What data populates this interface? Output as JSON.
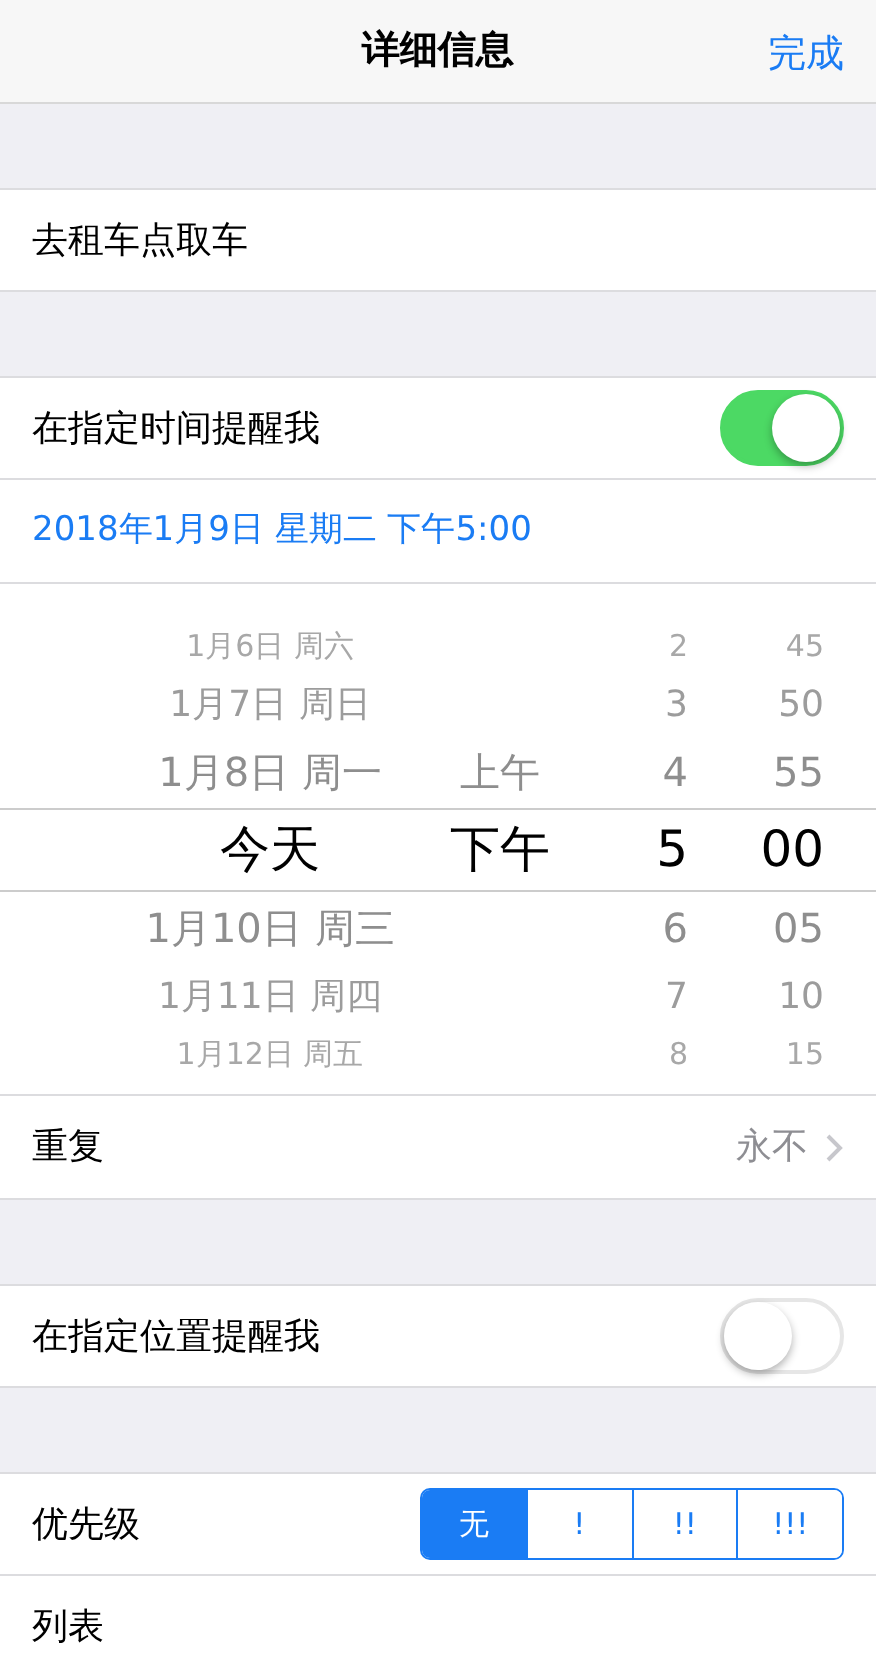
{
  "nav": {
    "title": "详细信息",
    "done": "完成"
  },
  "title_row": {
    "text": "去租车点取车"
  },
  "time_alert": {
    "label": "在指定时间提醒我",
    "on": true
  },
  "date_text": "2018年1月9日 星期二 下午5:00",
  "picker_rows": [
    {
      "date": "1月6日 周六",
      "period": "",
      "hour": "2",
      "minute": "45",
      "selected": false
    },
    {
      "date": "1月7日 周日",
      "period": "",
      "hour": "3",
      "minute": "50",
      "selected": false
    },
    {
      "date": "1月8日 周一",
      "period": "上午",
      "hour": "4",
      "minute": "55",
      "selected": false
    },
    {
      "date": "今天",
      "period": "下午",
      "hour": "5",
      "minute": "00",
      "selected": true
    },
    {
      "date": "1月10日 周三",
      "period": "",
      "hour": "6",
      "minute": "05",
      "selected": false
    },
    {
      "date": "1月11日 周四",
      "period": "",
      "hour": "7",
      "minute": "10",
      "selected": false
    },
    {
      "date": "1月12日 周五",
      "period": "",
      "hour": "8",
      "minute": "15",
      "selected": false
    }
  ],
  "repeat": {
    "label": "重复",
    "value": "永不"
  },
  "location_alert": {
    "label": "在指定位置提醒我",
    "on": false
  },
  "priority": {
    "label": "优先级",
    "options": [
      {
        "label": "无",
        "selected": true
      },
      {
        "label": "!",
        "selected": false
      },
      {
        "label": "!!",
        "selected": false
      },
      {
        "label": "!!!",
        "selected": false
      }
    ]
  },
  "list_row": {
    "label": "列表"
  }
}
